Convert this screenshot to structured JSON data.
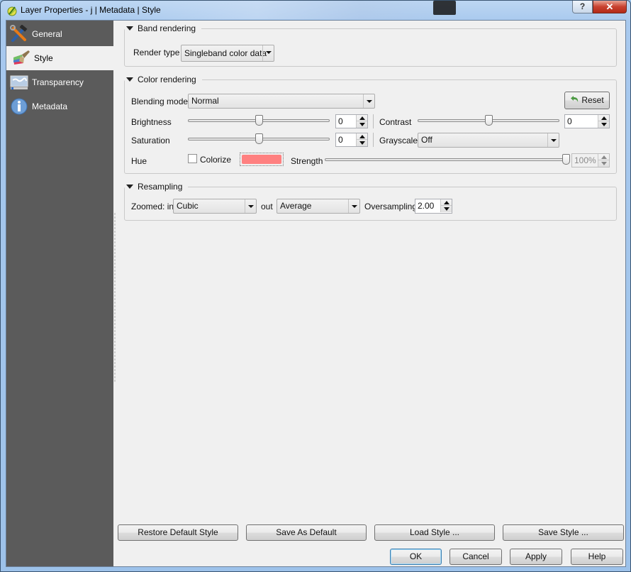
{
  "window": {
    "title": "Layer Properties - j | Metadata | Style",
    "help_button": "?",
    "close_button": "✕"
  },
  "sidebar": {
    "items": [
      {
        "label": "General",
        "icon": "hammer-wrench-icon",
        "selected": false
      },
      {
        "label": "Style",
        "icon": "paintbrush-icon",
        "selected": true
      },
      {
        "label": "Transparency",
        "icon": "transparency-map-icon",
        "selected": false
      },
      {
        "label": "Metadata",
        "icon": "info-icon",
        "selected": false
      }
    ]
  },
  "band_rendering": {
    "title": "Band rendering",
    "render_type_label": "Render type",
    "render_type_value": "Singleband color data"
  },
  "color_rendering": {
    "title": "Color rendering",
    "blending_mode_label": "Blending mode",
    "blending_mode_value": "Normal",
    "reset_label": "Reset",
    "brightness_label": "Brightness",
    "brightness_value": "0",
    "brightness_slider_fraction": 0.5,
    "contrast_label": "Contrast",
    "contrast_value": "0",
    "contrast_slider_fraction": 0.5,
    "saturation_label": "Saturation",
    "saturation_value": "0",
    "saturation_slider_fraction": 0.5,
    "grayscale_label": "Grayscale",
    "grayscale_value": "Off",
    "hue_label": "Hue",
    "colorize_label": "Colorize",
    "colorize_checked": false,
    "colorize_color": "#ff8080",
    "strength_label": "Strength",
    "strength_value": "100%",
    "strength_slider_fraction": 1.0
  },
  "resampling": {
    "title": "Resampling",
    "zoomed_in_label": "Zoomed: in",
    "zoomed_in_value": "Cubic",
    "out_label": "out",
    "zoomed_out_value": "Average",
    "oversampling_label": "Oversampling",
    "oversampling_value": "2.00"
  },
  "style_buttons": {
    "restore_default": "Restore Default Style",
    "save_as_default": "Save As Default",
    "load_style": "Load Style ...",
    "save_style": "Save Style ..."
  },
  "dialog_buttons": {
    "ok": "OK",
    "cancel": "Cancel",
    "apply": "Apply",
    "help": "Help"
  }
}
